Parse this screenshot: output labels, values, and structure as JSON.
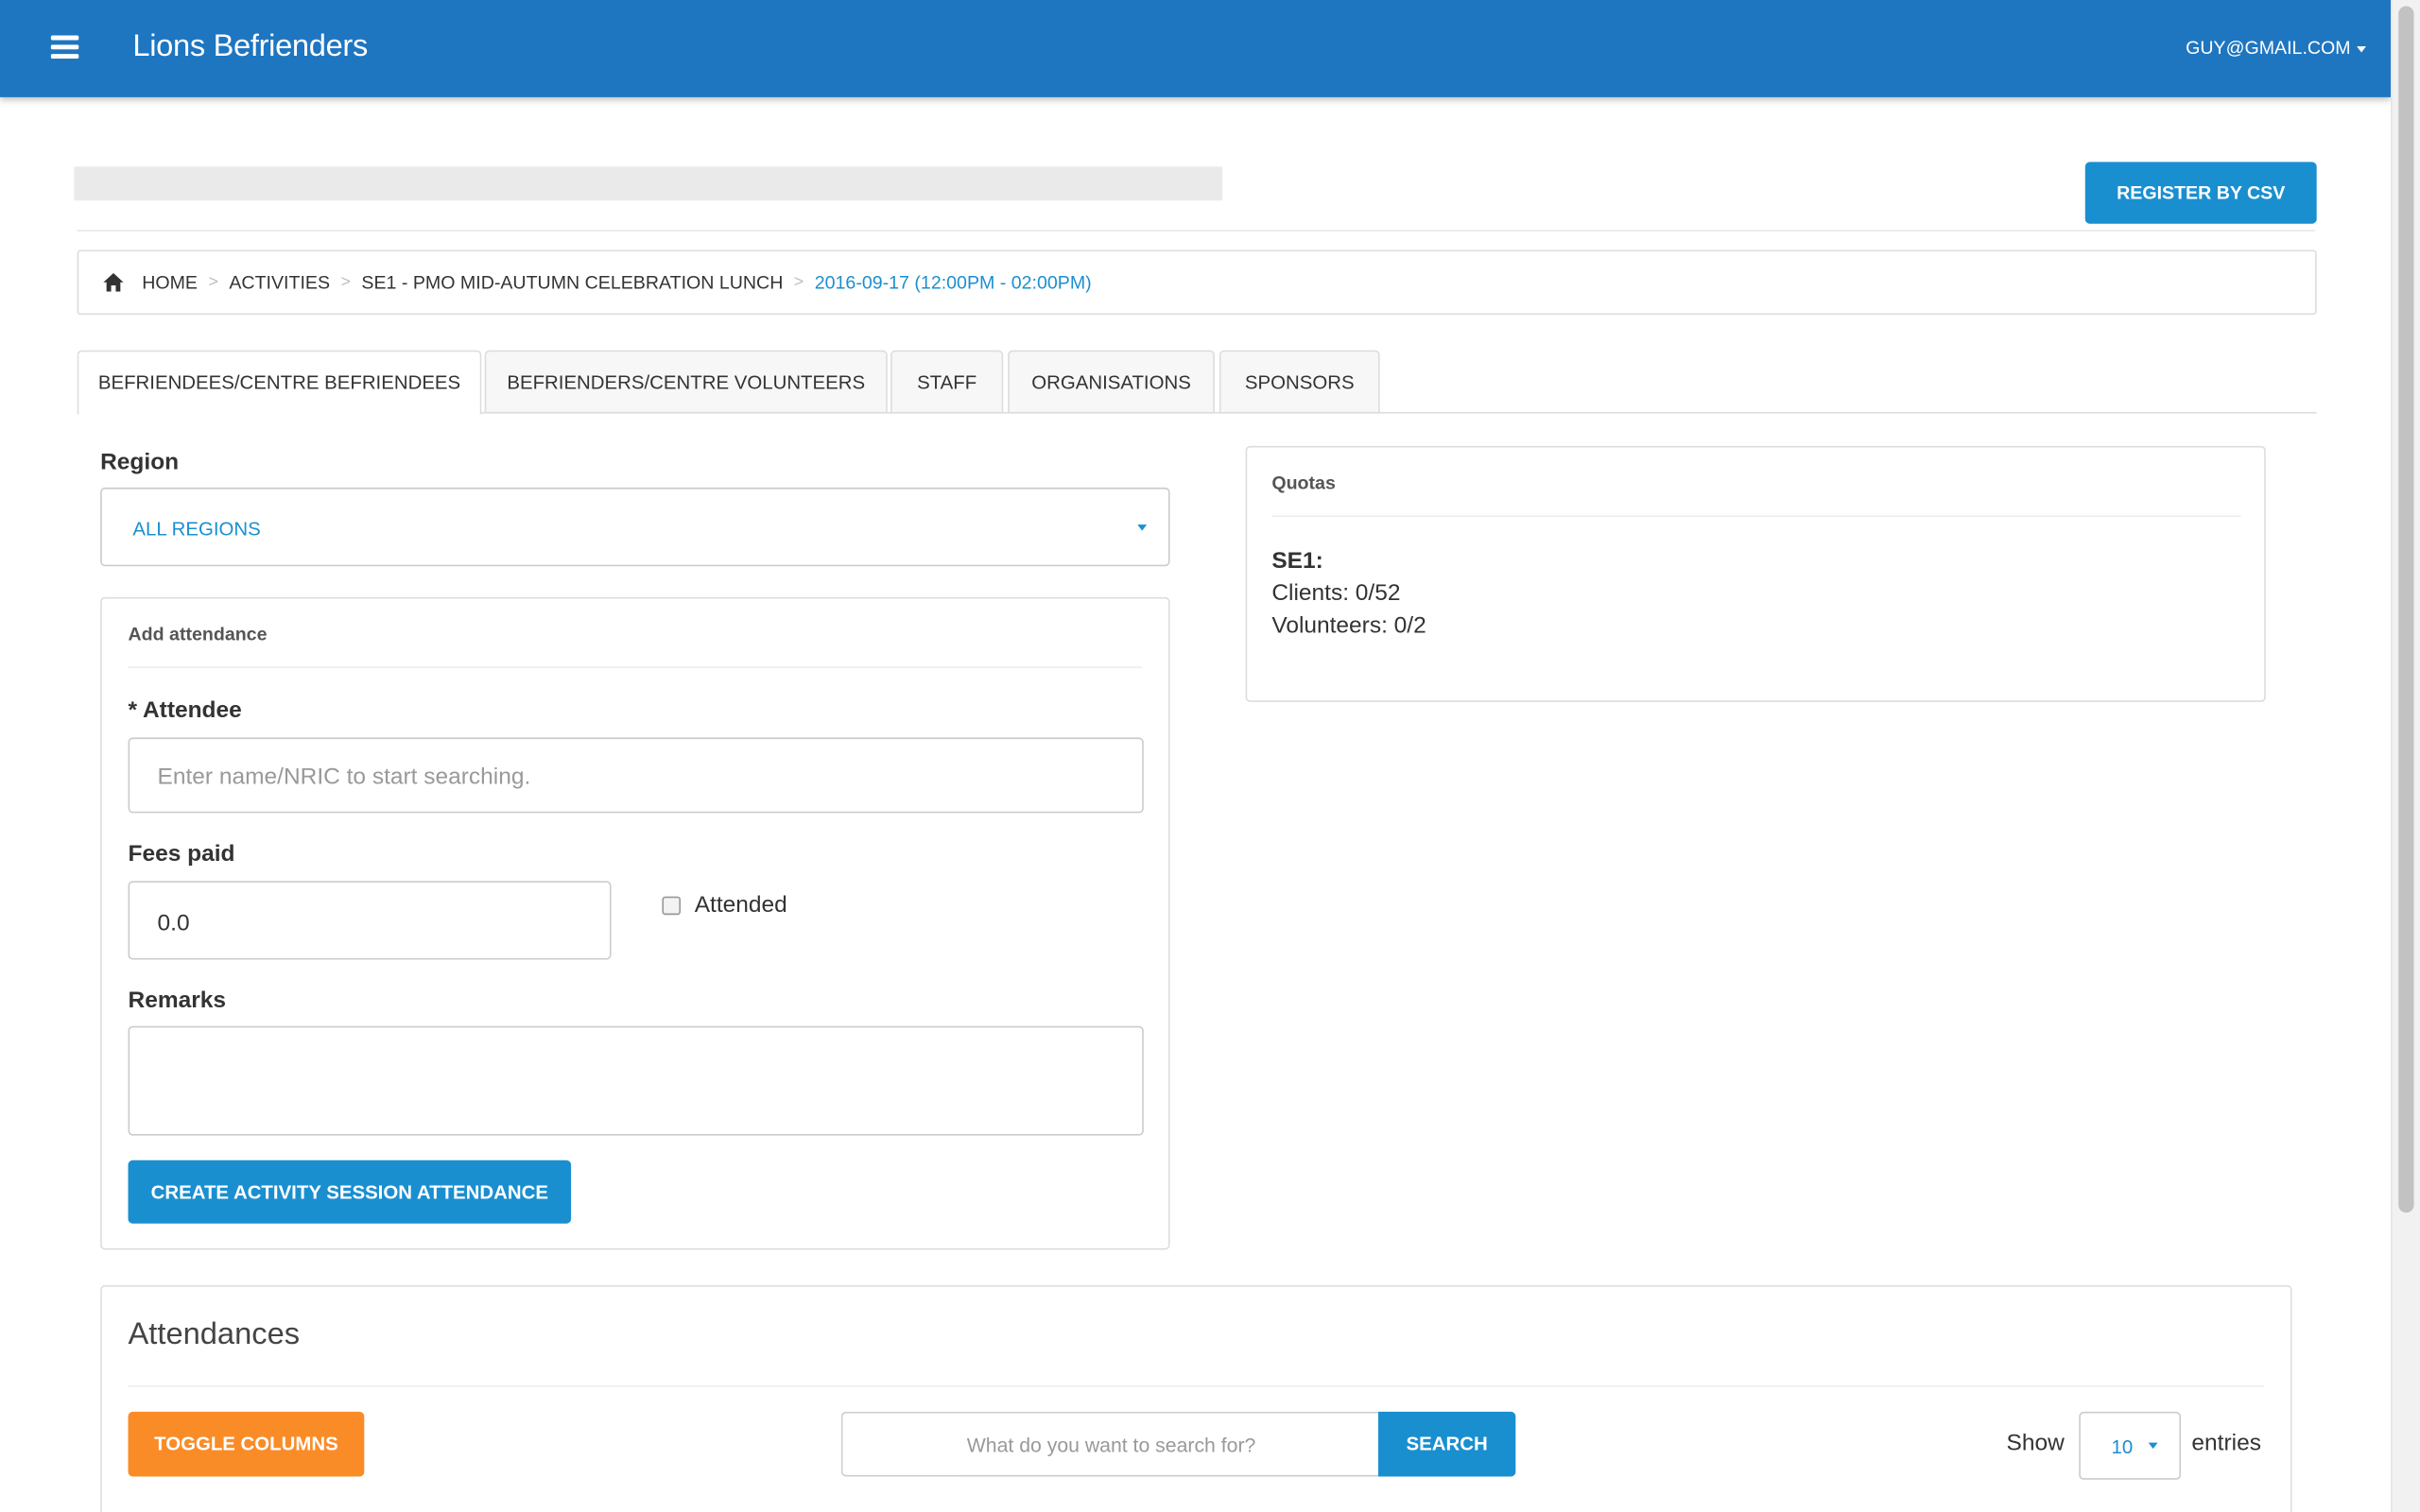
{
  "app": {
    "title": "Lions Befrienders",
    "user_email": "GUY@GMAIL.COM"
  },
  "header": {
    "register_csv_label": "REGISTER BY CSV"
  },
  "breadcrumb": {
    "items": [
      "HOME",
      "ACTIVITIES",
      "SE1 - PMO MID-AUTUMN CELEBRATION LUNCH"
    ],
    "current": "2016-09-17 (12:00PM - 02:00PM)",
    "separator": ">"
  },
  "tabs": [
    {
      "label": "BEFRIENDEES/CENTRE BEFRIENDEES",
      "active": true
    },
    {
      "label": "BEFRIENDERS/CENTRE VOLUNTEERS",
      "active": false
    },
    {
      "label": "STAFF",
      "active": false
    },
    {
      "label": "ORGANISATIONS",
      "active": false
    },
    {
      "label": "SPONSORS",
      "active": false
    }
  ],
  "region": {
    "label": "Region",
    "selected": "ALL REGIONS"
  },
  "add_attendance": {
    "title": "Add attendance",
    "attendee_required_mark": "*",
    "attendee_label": "Attendee",
    "attendee_placeholder": "Enter name/NRIC to start searching.",
    "fees_label": "Fees paid",
    "fees_value": "0.0",
    "attended_label": "Attended",
    "attended_checked": false,
    "remarks_label": "Remarks",
    "remarks_value": "",
    "submit_label": "CREATE ACTIVITY SESSION ATTENDANCE"
  },
  "quotas": {
    "title": "Quotas",
    "session": "SE1:",
    "clients": "Clients: 0/52",
    "volunteers": "Volunteers: 0/2"
  },
  "attendances": {
    "title": "Attendances",
    "toggle_columns_label": "TOGGLE COLUMNS",
    "search_placeholder": "What do you want to search for?",
    "search_button_label": "SEARCH",
    "show_label": "Show",
    "page_size": "10",
    "entries_label": "entries"
  },
  "colors": {
    "navbar": "#1f76c0",
    "primary": "#1a8fd0",
    "orange": "#fa8c28"
  },
  "icons": [
    "menu-icon",
    "caret-down-icon",
    "home-icon"
  ]
}
